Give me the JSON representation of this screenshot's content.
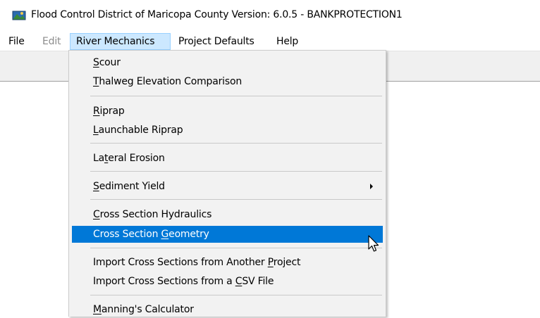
{
  "window": {
    "title": "Flood Control District of Maricopa County Version: 6.0.5 - BANKPROTECTION1",
    "icon": "app-icon"
  },
  "menubar": {
    "items": [
      {
        "label": "File",
        "state": "normal"
      },
      {
        "label": "Edit",
        "state": "disabled"
      },
      {
        "label": "River Mechanics",
        "state": "open"
      },
      {
        "label": "Project Defaults",
        "state": "normal"
      },
      {
        "label": "Help",
        "state": "normal"
      }
    ]
  },
  "dropdown": {
    "items": [
      {
        "pre": "",
        "key": "S",
        "post": "cour"
      },
      {
        "pre": "",
        "key": "T",
        "post": "halweg Elevation Comparison"
      },
      {
        "pre": "",
        "key": "R",
        "post": "iprap"
      },
      {
        "pre": "",
        "key": "L",
        "post": "aunchable Riprap"
      },
      {
        "pre": "La",
        "key": "t",
        "post": "eral Erosion"
      },
      {
        "pre": "",
        "key": "S",
        "post": "ediment Yield",
        "submenu": true
      },
      {
        "pre": "",
        "key": "C",
        "post": "ross Section Hydraulics"
      },
      {
        "pre": "Cross Section ",
        "key": "G",
        "post": "eometry",
        "highlighted": true
      },
      {
        "pre": "Import Cross Sections from Another ",
        "key": "P",
        "post": "roject"
      },
      {
        "pre": "Import Cross Sections from a ",
        "key": "C",
        "post": "SV File"
      },
      {
        "pre": "",
        "key": "M",
        "post": "anning's Calculator"
      }
    ]
  },
  "colors": {
    "highlight": "#0078d7",
    "open_menu_bg": "#cce8ff",
    "open_menu_border": "#99d1ff",
    "menu_bg": "#f2f2f2",
    "toolbar_bg": "#f0f0f0",
    "disabled_text": "#8c8c8c"
  }
}
